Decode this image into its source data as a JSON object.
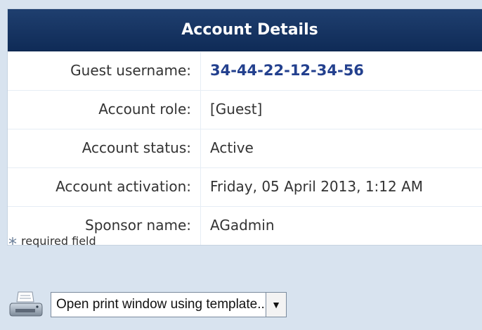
{
  "panel": {
    "title": "Account Details",
    "rows": [
      {
        "label": "Guest username:",
        "value": "34-44-22-12-34-56"
      },
      {
        "label": "Account role:",
        "value": "[Guest]"
      },
      {
        "label": "Account status:",
        "value": "Active"
      },
      {
        "label": "Account activation:",
        "value": "Friday, 05 April 2013, 1:12 AM"
      },
      {
        "label": "Sponsor name:",
        "value": "AGadmin"
      }
    ]
  },
  "required_note": {
    "marker": "*",
    "text": "required field"
  },
  "print": {
    "icon": "printer-icon",
    "select_value": "Open print window using template...",
    "arrow": "▼"
  },
  "colors": {
    "header_bg": "#163765",
    "page_bg": "#d8e3ef",
    "emph_value": "#23408e"
  }
}
